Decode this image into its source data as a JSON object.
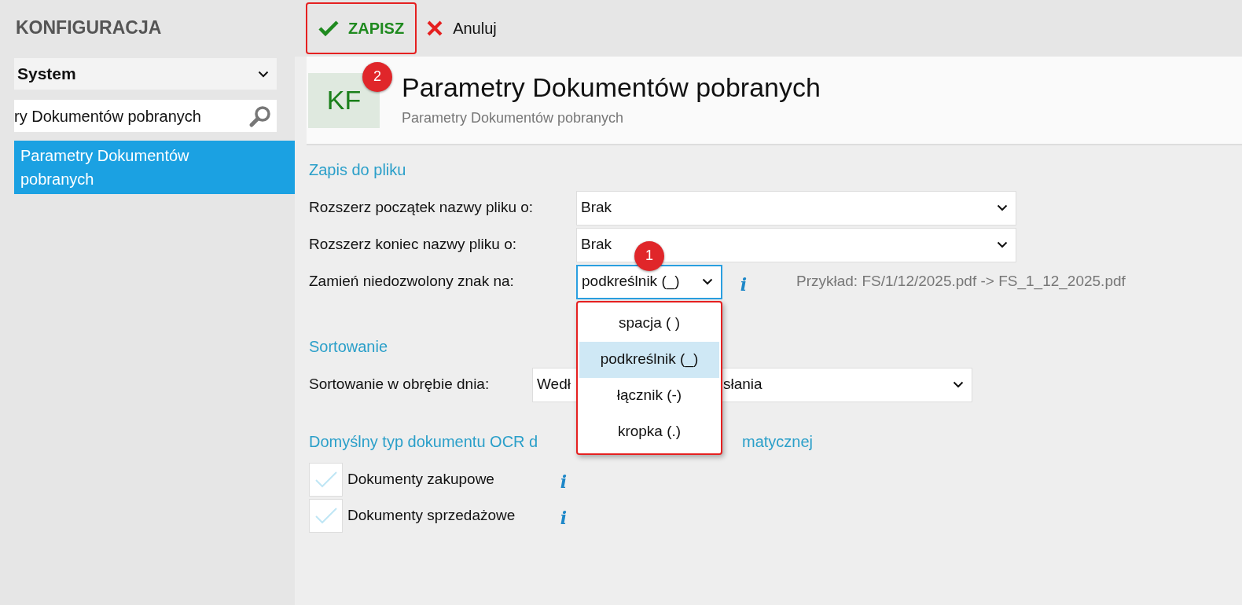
{
  "sidebar": {
    "title": "KONFIGURACJA",
    "module_select": {
      "value": "System"
    },
    "search": {
      "value": "ry Dokumentów pobranych"
    },
    "items": [
      {
        "label": "Parametry Dokumentów pobranych",
        "selected": true
      }
    ]
  },
  "toolbar": {
    "buttons": [
      {
        "kind": "save",
        "label": "ZAPISZ",
        "highlighted": true
      },
      {
        "kind": "cancel",
        "label": "Anuluj",
        "highlighted": false
      }
    ]
  },
  "header": {
    "logo": "KF",
    "badge": "2",
    "title": "Parametry Dokumentów pobranych",
    "subtitle": "Parametry Dokumentów pobranych"
  },
  "sections": [
    {
      "kind": "selects",
      "title_parts": [
        "Zapis do pliku"
      ],
      "rows": [
        {
          "label": "Rozszerz początek nazwy pliku o:",
          "value_parts": [
            "Brak"
          ],
          "focused": false,
          "open": false
        },
        {
          "label": "Rozszerz koniec nazwy pliku o:",
          "value_parts": [
            "Brak"
          ],
          "focused": false,
          "open": false
        },
        {
          "label": "Zamień niedozwolony znak na:",
          "value_parts": [
            "podkreślnik (_)"
          ],
          "focused": true,
          "badge": "1",
          "info_icon": "i",
          "example": "Przykład: FS/1/12/2025.pdf -> FS_1_12_2025.pdf",
          "open": true
        }
      ]
    },
    {
      "kind": "selects",
      "title_parts": [
        "Sortowanie"
      ],
      "rows": [
        {
          "label": "Sortowanie w obrębie dnia:",
          "value_parts": [
            "Wedł",
            "słania"
          ],
          "focused": false,
          "open": false
        }
      ]
    },
    {
      "kind": "checks",
      "title_parts": [
        "Domyślny typ dokumentu OCR d",
        "matycznej"
      ],
      "rows": [
        {
          "label": "Dokumenty zakupowe",
          "checked": false,
          "info_icon": "i"
        },
        {
          "label": "Dokumenty sprzedażowe",
          "checked": false,
          "info_icon": "i"
        }
      ]
    }
  ],
  "dropdown": {
    "highlighted": true,
    "options": [
      {
        "label": "spacja ( )",
        "selected": false
      },
      {
        "label": "podkreślnik (_)",
        "selected": true
      },
      {
        "label": "łącznik (-)",
        "selected": false
      },
      {
        "label": "kropka (.)",
        "selected": false
      }
    ]
  }
}
